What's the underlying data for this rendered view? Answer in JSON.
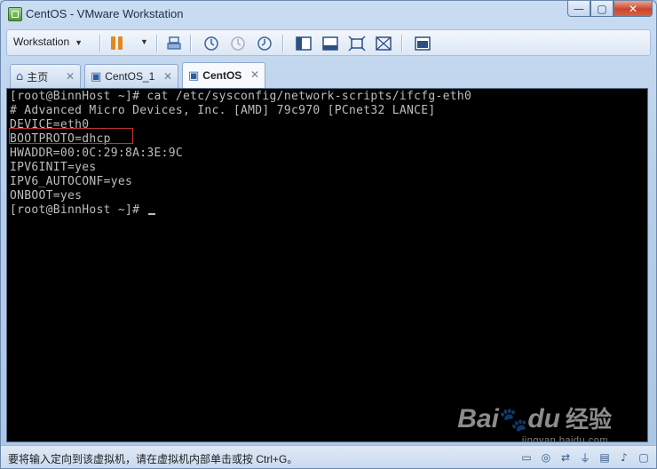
{
  "window": {
    "title": "CentOS - VMware Workstation"
  },
  "titlebar_buttons": {
    "minimize": "—",
    "maximize": "▢",
    "close": "✕"
  },
  "toolbar": {
    "menu_label": "Workstation",
    "menu_caret": "▼",
    "power_caret": "▼"
  },
  "tabs": [
    {
      "label": "主页",
      "icon": "home-icon",
      "close": "✕"
    },
    {
      "label": "CentOS_1",
      "icon": "vm-icon",
      "close": "✕"
    },
    {
      "label": "CentOS",
      "icon": "vm-icon",
      "close": "✕"
    }
  ],
  "console": {
    "lines": [
      "[root@BinnHost ~]# cat /etc/sysconfig/network-scripts/ifcfg-eth0",
      "# Advanced Micro Devices, Inc. [AMD] 79c970 [PCnet32 LANCE]",
      "DEVICE=eth0",
      "BOOTPROTO=dhcp",
      "HWADDR=00:0C:29:8A:3E:9C",
      "IPV6INIT=yes",
      "IPV6_AUTOCONF=yes",
      "ONBOOT=yes",
      "[root@BinnHost ~]# "
    ]
  },
  "watermark": {
    "brand": "Bai",
    "paw": "🐾",
    "brand_end": "du",
    "cn": "经验",
    "sub": "jingyan.baidu.com"
  },
  "statusbar": {
    "text": "要将输入定向到该虚拟机，请在虚拟机内部单击或按 Ctrl+G。"
  },
  "colors": {
    "console_bg": "#000000",
    "console_text": "#bdbdbd",
    "highlight_box": "#c43030",
    "pause": "#e08a1c"
  }
}
